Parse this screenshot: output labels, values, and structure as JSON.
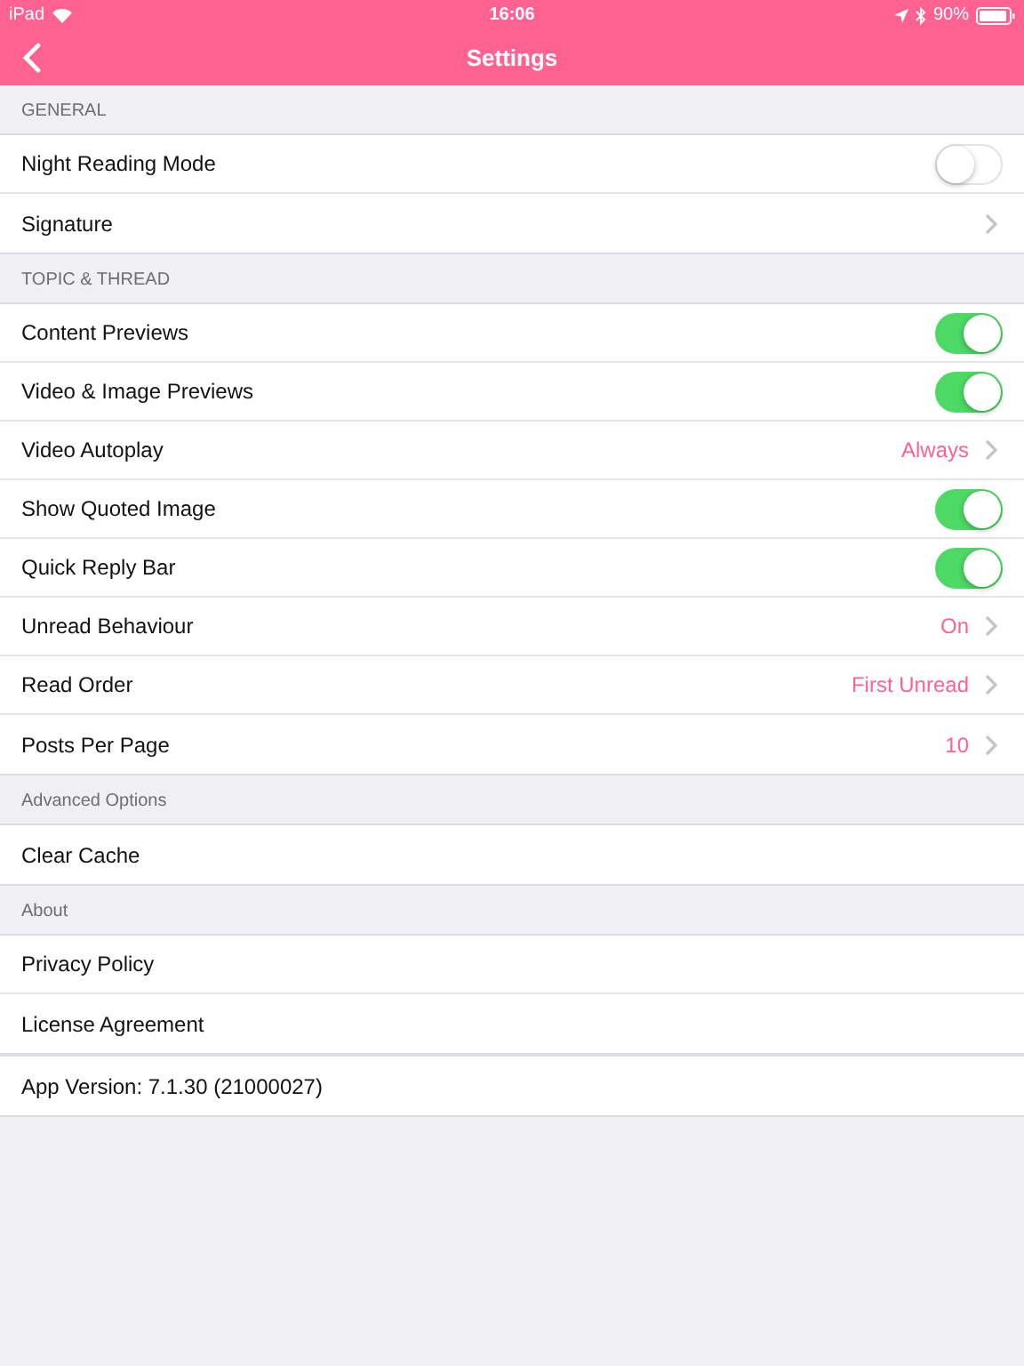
{
  "status_bar": {
    "device": "iPad",
    "time": "16:06",
    "battery": "90%"
  },
  "nav": {
    "title": "Settings"
  },
  "sections": [
    {
      "header": "GENERAL",
      "rows": [
        {
          "kind": "toggle",
          "label": "Night Reading Mode",
          "on": false
        },
        {
          "kind": "link",
          "label": "Signature"
        }
      ]
    },
    {
      "header": "TOPIC & THREAD",
      "rows": [
        {
          "kind": "toggle",
          "label": "Content Previews",
          "on": true
        },
        {
          "kind": "toggle",
          "label": "Video & Image Previews",
          "on": true
        },
        {
          "kind": "link",
          "label": "Video Autoplay",
          "value": "Always"
        },
        {
          "kind": "toggle",
          "label": "Show Quoted Image",
          "on": true
        },
        {
          "kind": "toggle",
          "label": "Quick Reply Bar",
          "on": true
        },
        {
          "kind": "link",
          "label": "Unread Behaviour",
          "value": "On"
        },
        {
          "kind": "link",
          "label": "Read Order",
          "value": "First Unread"
        },
        {
          "kind": "link",
          "label": "Posts Per Page",
          "value": "10"
        }
      ]
    },
    {
      "header": "Advanced Options",
      "rows": [
        {
          "kind": "plain",
          "label": "Clear Cache"
        }
      ]
    },
    {
      "header": "About",
      "rows": [
        {
          "kind": "plain",
          "label": "Privacy Policy"
        },
        {
          "kind": "plain",
          "label": "License Agreement"
        }
      ]
    },
    {
      "rows": [
        {
          "kind": "plain",
          "label": "App Version: 7.1.30 (21000027)"
        }
      ]
    }
  ]
}
